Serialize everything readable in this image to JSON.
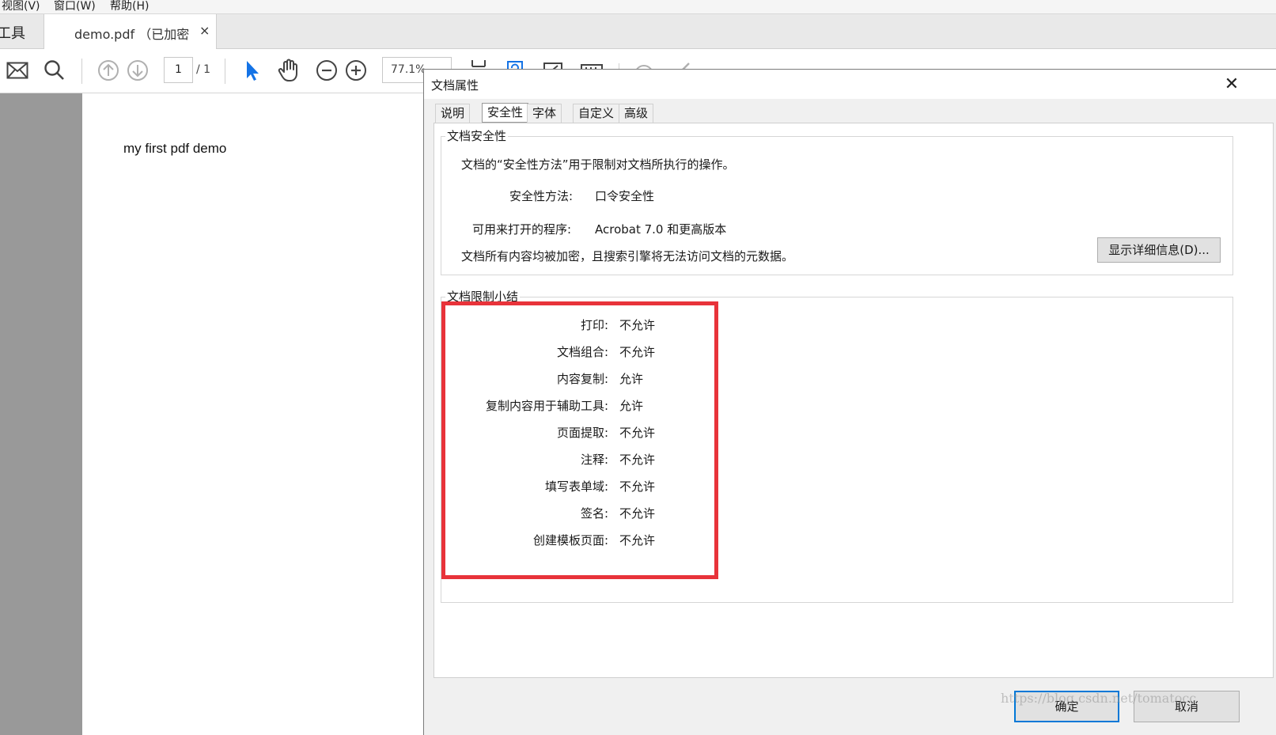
{
  "menubar": {
    "items": [
      "视图(V)",
      "窗口(W)",
      "帮助(H)"
    ]
  },
  "tabs": {
    "tools_label": "工具",
    "doc_label": "demo.pdf （已加密",
    "close_glyph": "×"
  },
  "toolbar": {
    "page_current": "1",
    "page_total": "/ 1",
    "zoom": "77.1%"
  },
  "document": {
    "text": "my first pdf demo"
  },
  "dialog": {
    "title": "文档属性",
    "close_glyph": "✕",
    "tabs": [
      "说明",
      "安全性",
      "字体",
      "自定义",
      "高级"
    ],
    "active_tab": "安全性",
    "security_group": {
      "title": "文档安全性",
      "intro": "文档的“安全性方法”用于限制对文档所执行的操作。",
      "method_label": "安全性方法:",
      "method_value": "口令安全性",
      "compat_label": "可用来打开的程序:",
      "compat_value": "Acrobat 7.0 和更高版本",
      "note": "文档所有内容均被加密，且搜索引擎将无法访问文档的元数据。",
      "details_button": "显示详细信息(D)..."
    },
    "restrictions_group": {
      "title": "文档限制小结",
      "rows": [
        {
          "label": "打印:",
          "value": "不允许"
        },
        {
          "label": "文档组合:",
          "value": "不允许"
        },
        {
          "label": "内容复制:",
          "value": "允许"
        },
        {
          "label": "复制内容用于辅助工具:",
          "value": "允许"
        },
        {
          "label": "页面提取:",
          "value": "不允许"
        },
        {
          "label": "注释:",
          "value": "不允许"
        },
        {
          "label": "填写表单域:",
          "value": "不允许"
        },
        {
          "label": "签名:",
          "value": "不允许"
        },
        {
          "label": "创建模板页面:",
          "value": "不允许"
        }
      ]
    },
    "ok_button": "确定",
    "cancel_button": "取消"
  },
  "watermark": "https://blog.csdn.net/tomatocc",
  "colors": {
    "highlight": "#e8333a",
    "select_tool": "#1473e6",
    "default_button_border": "#0078d7"
  }
}
